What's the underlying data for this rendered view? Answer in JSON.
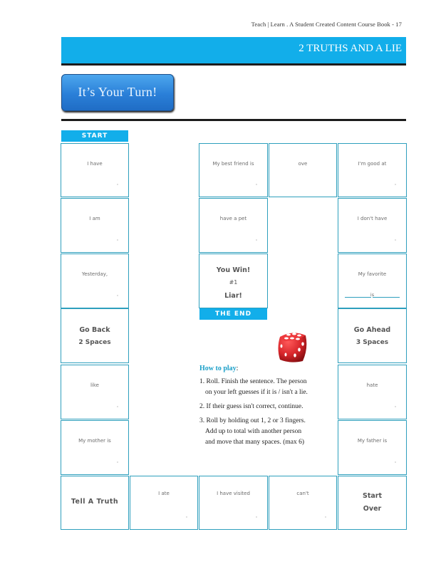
{
  "running_head": "Teach | Learn . A Student Created Content Course Book - 17",
  "header": {
    "title": "2 TRUTHS AND A LIE",
    "color": "#12aeea"
  },
  "turn_button": {
    "label": "It’s Your Turn!"
  },
  "board": {
    "start_label": "START",
    "end_label": "THE END",
    "border_color": "#2e9fbd",
    "cells": {
      "r1c1": "I have",
      "r1c3": "My best friend is",
      "r1c4": "ove",
      "r1c5": "I'm good at",
      "r2c1": "I am",
      "r2c3": "have a pet",
      "r2c5": "I don't have",
      "r3c1": "Yesterday,",
      "r3c3": {
        "line1": "You Win!",
        "line2": "#1",
        "line3": "Liar!"
      },
      "r3c5": {
        "text": "My favorite",
        "blank_connector": "is"
      },
      "r4c1": {
        "line1": "Go Back",
        "line2": "2 Spaces"
      },
      "r4c5": {
        "line1": "Go Ahead",
        "line2": "3 Spaces"
      },
      "r5c1": "like",
      "r5c5": "hate",
      "r6c1": "My mother is",
      "r6c5": "My father is",
      "r7c1": "Tell A Truth",
      "r7c2": "I ate",
      "r7c3": "I have visited",
      "r7c4": "can't",
      "r7c5": {
        "line1": "Start",
        "line2": "Over"
      }
    }
  },
  "dice": {
    "icon": "red-die-icon",
    "color": "#d8262b"
  },
  "how_to_play": {
    "heading": "How to play",
    "heading_suffix": ":",
    "steps": [
      {
        "line1": "1. Roll. Finish the sentence. The person",
        "line2": "on your left guesses if it is / isn't a lie."
      },
      {
        "line1": "2. If their guess isn't correct, continue."
      },
      {
        "line1": "3. Roll by holding out 1, 2 or 3 fingers.",
        "line2": "Add up to total with another person",
        "line3": "and move that many spaces. (max 6)"
      }
    ]
  }
}
